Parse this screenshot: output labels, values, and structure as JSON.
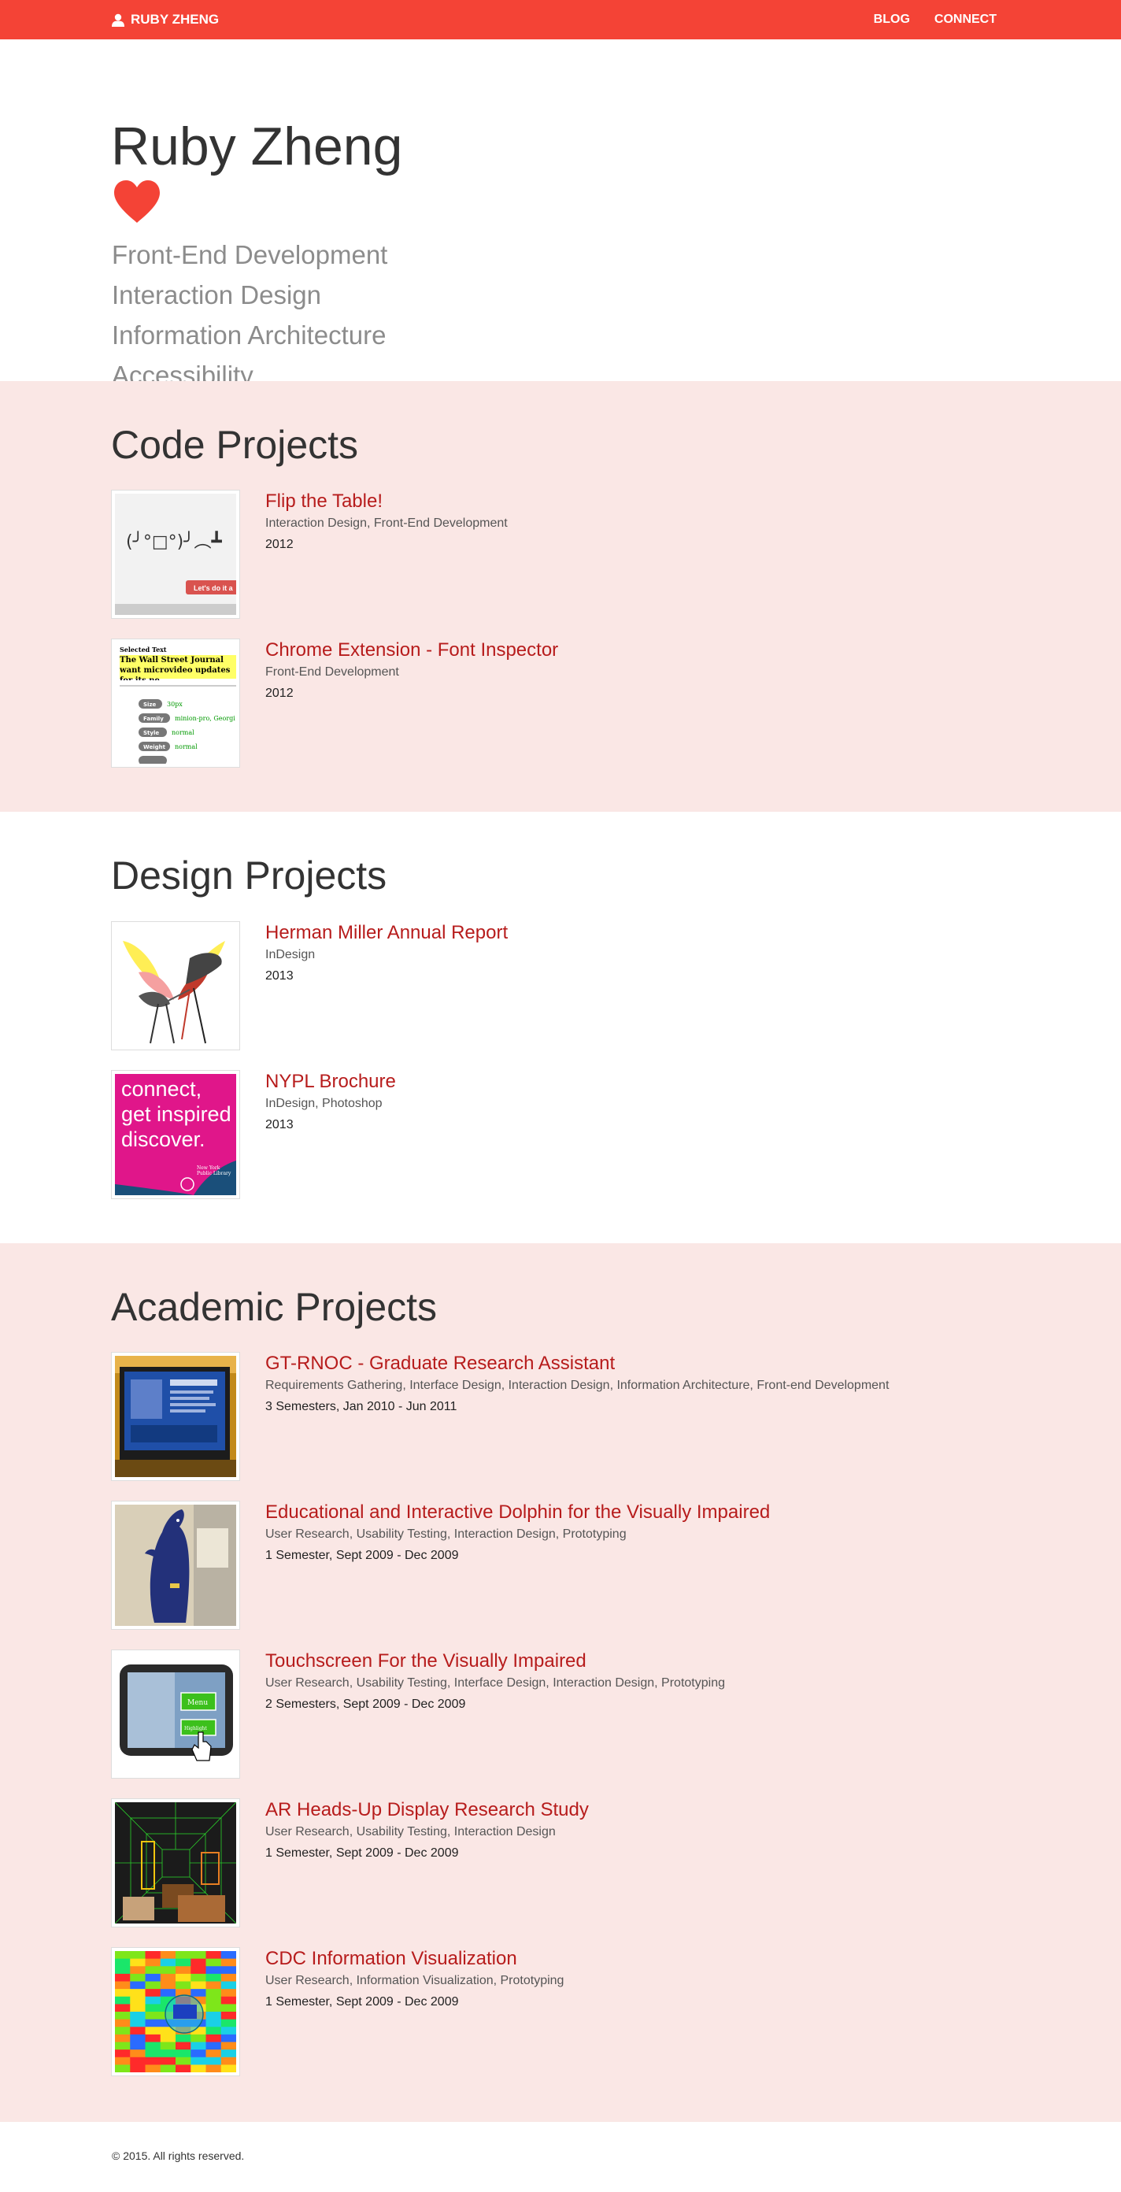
{
  "colors": {
    "brand": "#f44336",
    "section_pink": "#fae7e5",
    "project_link": "#b71c1c",
    "skill_text": "#8c8c8c"
  },
  "navbar": {
    "brand_label": "RUBY ZHENG",
    "brand_icon": "user-icon",
    "links": [
      "BLOG",
      "CONNECT"
    ]
  },
  "hero": {
    "name": "Ruby Zheng",
    "icon": "heart-icon",
    "skills": [
      "Front-End Development",
      "Interaction Design",
      "Information Architecture",
      "Accessibility"
    ]
  },
  "sections": [
    {
      "title": "Code Projects",
      "projects": [
        {
          "title": "Flip the Table!",
          "tags": "Interaction Design, Front-End Development",
          "date": "2012",
          "thumb": {
            "text": "(╯°□°)╯︵┻",
            "button": "Let's do it a"
          }
        },
        {
          "title": "Chrome Extension - Font Inspector",
          "tags": "Front-End Development",
          "date": "2012",
          "thumb": {
            "heading": "Selected Text",
            "sample": "The Wall Street Journal want microvideo updates for its ne",
            "props": [
              {
                "label": "Size",
                "value": "30px"
              },
              {
                "label": "Family",
                "value": "minion-pro, Georgi"
              },
              {
                "label": "Style",
                "value": "normal"
              },
              {
                "label": "Weight",
                "value": "normal"
              }
            ]
          }
        }
      ]
    },
    {
      "title": "Design Projects",
      "projects": [
        {
          "title": "Herman Miller Annual Report",
          "tags": "InDesign",
          "date": "2013"
        },
        {
          "title": "NYPL Brochure",
          "tags": "InDesign, Photoshop",
          "date": "2013",
          "thumb": {
            "lines": [
              "connect,",
              "get inspired",
              "discover."
            ],
            "logo": "New York Public Library"
          }
        }
      ]
    },
    {
      "title": "Academic Projects",
      "projects": [
        {
          "title": "GT-RNOC - Graduate Research Assistant",
          "tags": "Requirements Gathering, Interface Design, Interaction Design, Information Architecture, Front-end Development",
          "date": "3 Semesters, Jan 2010 - Jun 2011"
        },
        {
          "title": "Educational and Interactive Dolphin for the Visually Impaired",
          "tags": "User Research, Usability Testing, Interaction Design, Prototyping",
          "date": "1 Semester, Sept 2009 - Dec 2009"
        },
        {
          "title": "Touchscreen For the Visually Impaired",
          "tags": "User Research, Usability Testing, Interface Design, Interaction Design, Prototyping",
          "date": "2 Semesters, Sept 2009 - Dec 2009",
          "thumb": {
            "buttons": [
              "Menu",
              "Highlight"
            ]
          }
        },
        {
          "title": "AR Heads-Up Display Research Study",
          "tags": "User Research, Usability Testing, Interaction Design",
          "date": "1 Semester, Sept 2009 - Dec 2009"
        },
        {
          "title": "CDC Information Visualization",
          "tags": "User Research, Information Visualization, Prototyping",
          "date": "1 Semester, Sept 2009 - Dec 2009"
        }
      ]
    }
  ],
  "footer": {
    "text": "© 2015. All rights reserved."
  }
}
